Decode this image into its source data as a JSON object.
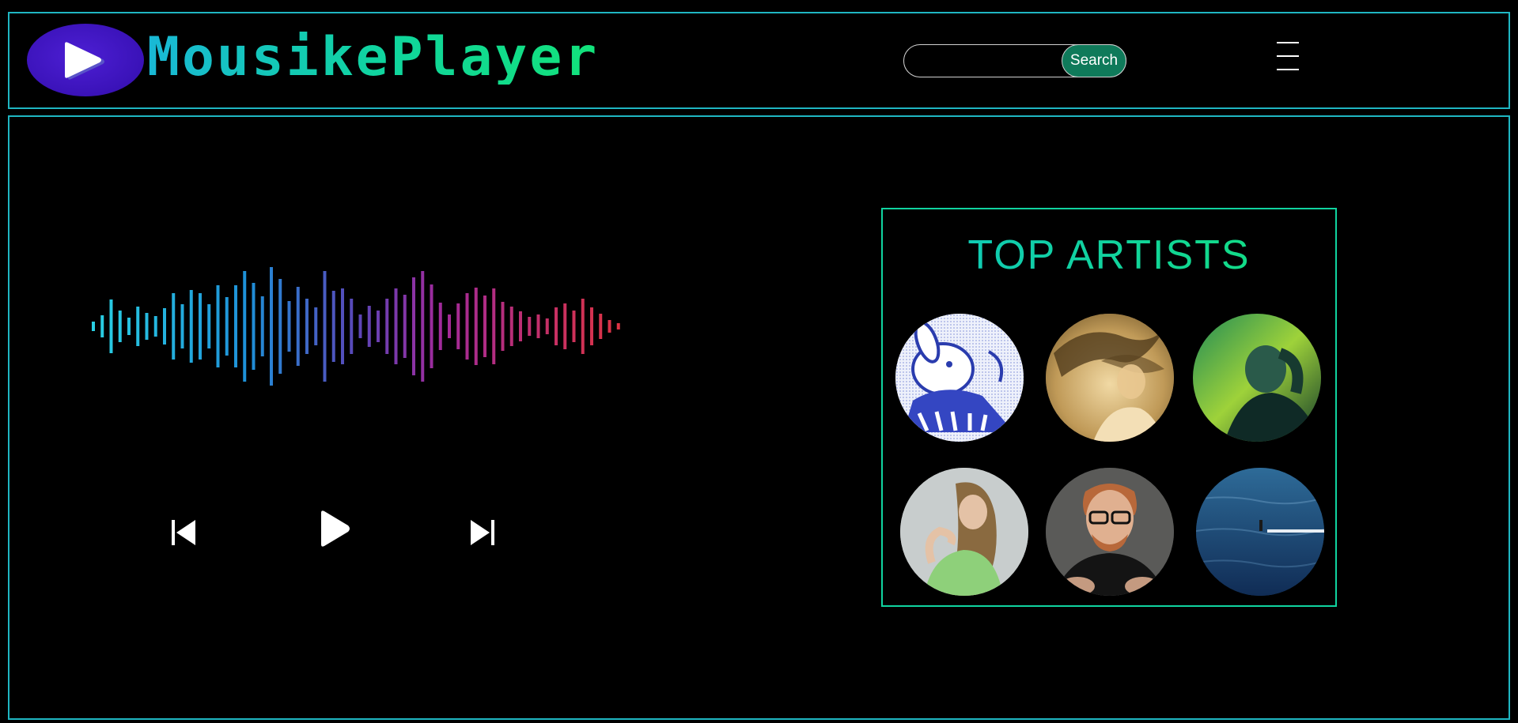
{
  "header": {
    "brand": "MousikePlayer",
    "logo_icon": "play-logo-icon",
    "search_placeholder": "",
    "search_label": "Search",
    "menu_icon": "hamburger-menu-icon"
  },
  "player": {
    "waveform_icon": "audio-waveform-icon",
    "controls": {
      "previous_icon": "skip-previous-icon",
      "play_icon": "play-icon",
      "next_icon": "skip-next-icon"
    }
  },
  "top_artists": {
    "title": "TOP ARTISTS",
    "artists": [
      {
        "image": "newjeans-bunny-album-art"
      },
      {
        "image": "gold-toned-portrait-flowing-hair"
      },
      {
        "image": "green-lit-portrait"
      },
      {
        "image": "portrait-green-top"
      },
      {
        "image": "portrait-glasses-black-shirt"
      },
      {
        "image": "ocean-waves-album-art"
      }
    ]
  },
  "colors": {
    "border": "#1fb6c2",
    "accent_green": "#12e27a",
    "search_button": "#0f7a5a",
    "logo_purple": "#3a12b8"
  }
}
